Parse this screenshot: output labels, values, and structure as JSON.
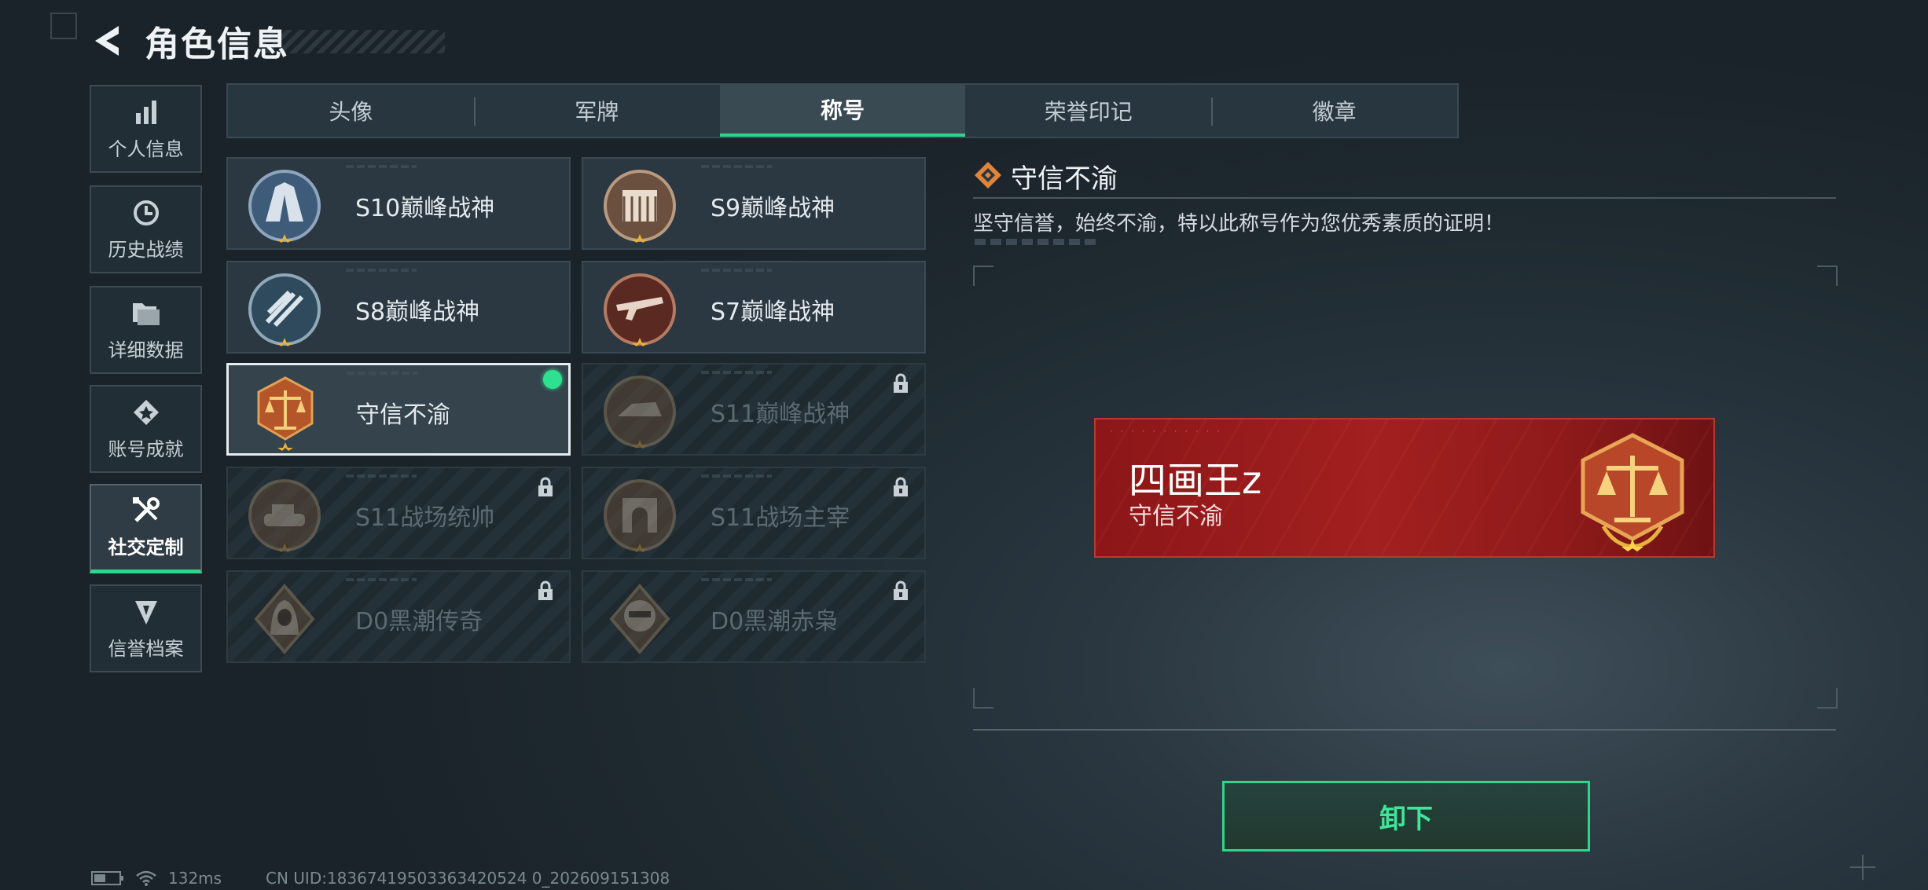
{
  "header": {
    "title": "角色信息"
  },
  "sidebar": {
    "items": [
      {
        "label": "个人信息",
        "icon": "bar-chart-icon"
      },
      {
        "label": "历史战绩",
        "icon": "history-clock-icon"
      },
      {
        "label": "详细数据",
        "icon": "folder-icon"
      },
      {
        "label": "账号成就",
        "icon": "achievement-icon"
      },
      {
        "label": "社交定制",
        "icon": "wrench-screwdriver-icon",
        "active": true
      },
      {
        "label": "信誉档案",
        "icon": "reputation-icon"
      }
    ]
  },
  "tabs": [
    {
      "label": "头像"
    },
    {
      "label": "军牌"
    },
    {
      "label": "称号",
      "active": true
    },
    {
      "label": "荣誉印记"
    },
    {
      "label": "徽章"
    }
  ],
  "titles": [
    {
      "name": "S10巅峰战神",
      "locked": false,
      "icon": "s10-emblem-icon"
    },
    {
      "name": "S9巅峰战神",
      "locked": false,
      "icon": "s9-emblem-icon"
    },
    {
      "name": "S8巅峰战神",
      "locked": false,
      "icon": "s8-emblem-icon"
    },
    {
      "name": "S7巅峰战神",
      "locked": false,
      "icon": "s7-emblem-icon"
    },
    {
      "name": "守信不渝",
      "locked": false,
      "selected": true,
      "equipped": true,
      "icon": "scales-emblem-icon"
    },
    {
      "name": "S11巅峰战神",
      "locked": true,
      "icon": "s11-emblem-icon"
    },
    {
      "name": "S11战场统帅",
      "locked": true,
      "icon": "tank-emblem-icon"
    },
    {
      "name": "S11战场主宰",
      "locked": true,
      "icon": "arch-emblem-icon"
    },
    {
      "name": "D0黑潮传奇",
      "locked": true,
      "icon": "hooded-figure-emblem-icon"
    },
    {
      "name": "D0黑潮赤枭",
      "locked": true,
      "icon": "masked-soldier-emblem-icon"
    }
  ],
  "detail": {
    "title": "守信不渝",
    "description": "坚守信誉，始终不渝，特以此称号作为您优秀素质的证明！",
    "nameplate": {
      "player_name": "四画王z",
      "title": "守信不渝"
    },
    "unequip_label": "卸下"
  },
  "status": {
    "ping": "132ms",
    "uid": "CN UID:18367419503363420524 0_202609151308"
  },
  "colors": {
    "accent": "#2fd58a",
    "nameplate": "#a2201f",
    "emblem_bronze": "#b5652a"
  }
}
